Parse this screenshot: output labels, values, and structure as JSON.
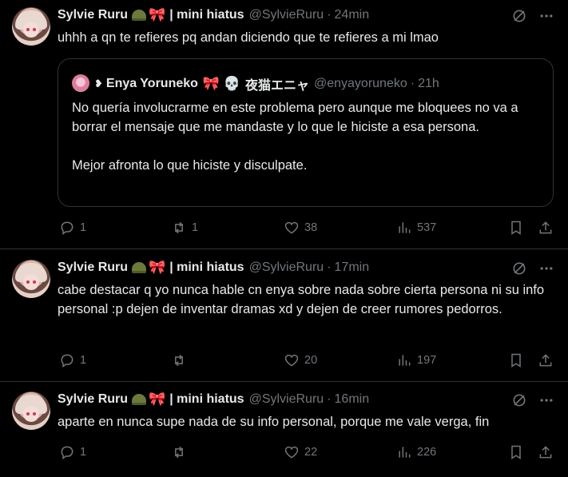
{
  "tweets": [
    {
      "author": {
        "name": "Sylvie Ruru",
        "emoji": "🎀",
        "suffix": "| mini hiatus",
        "handle": "@SylvieRuru"
      },
      "time": "24min",
      "text": "uhhh a qn te refieres pq andan diciendo que te refieres a mi lmao",
      "quote": {
        "author": {
          "prefix": "❥",
          "name": "Enya Yoruneko",
          "emoji": "🎀 💀",
          "suffix": "夜猫エニャ",
          "handle": "@enyayoruneko"
        },
        "time": "21h",
        "paragraphs": [
          "No quería involucrarme en este problema pero aunque me bloquees no va a borrar el mensaje que me mandaste y lo que le hiciste a esa persona.",
          "Mejor afronta lo que hiciste y disculpate."
        ]
      },
      "stats": {
        "replies": "1",
        "reposts": "1",
        "likes": "38",
        "views": "537"
      }
    },
    {
      "author": {
        "name": "Sylvie Ruru",
        "emoji": "🎀",
        "suffix": "| mini hiatus",
        "handle": "@SylvieRuru"
      },
      "time": "17min",
      "text": "cabe destacar q yo nunca hable cn enya sobre nada sobre cierta persona ni su info personal :p dejen de inventar dramas xd y dejen de creer rumores pedorros.",
      "stats": {
        "replies": "1",
        "reposts": "",
        "likes": "20",
        "views": "197"
      }
    },
    {
      "author": {
        "name": "Sylvie Ruru",
        "emoji": "🎀",
        "suffix": "| mini hiatus",
        "handle": "@SylvieRuru"
      },
      "time": "16min",
      "text": "aparte en nunca supe nada de su info personal, porque me vale verga, fin",
      "stats": {
        "replies": "1",
        "reposts": "",
        "likes": "22",
        "views": "226"
      }
    }
  ],
  "separator": "·",
  "icons": {
    "reply": "reply-icon",
    "repost": "repost-icon",
    "like": "heart-icon",
    "views": "views-icon",
    "bookmark": "bookmark-icon",
    "share": "share-icon",
    "grok": "grok-icon",
    "more": "more-icon",
    "helmet": "helmet-icon"
  },
  "colors": {
    "background": "#000000",
    "text": "#e7e9ea",
    "muted": "#71767b",
    "border": "#2f3336",
    "bow": "#e0245e"
  }
}
